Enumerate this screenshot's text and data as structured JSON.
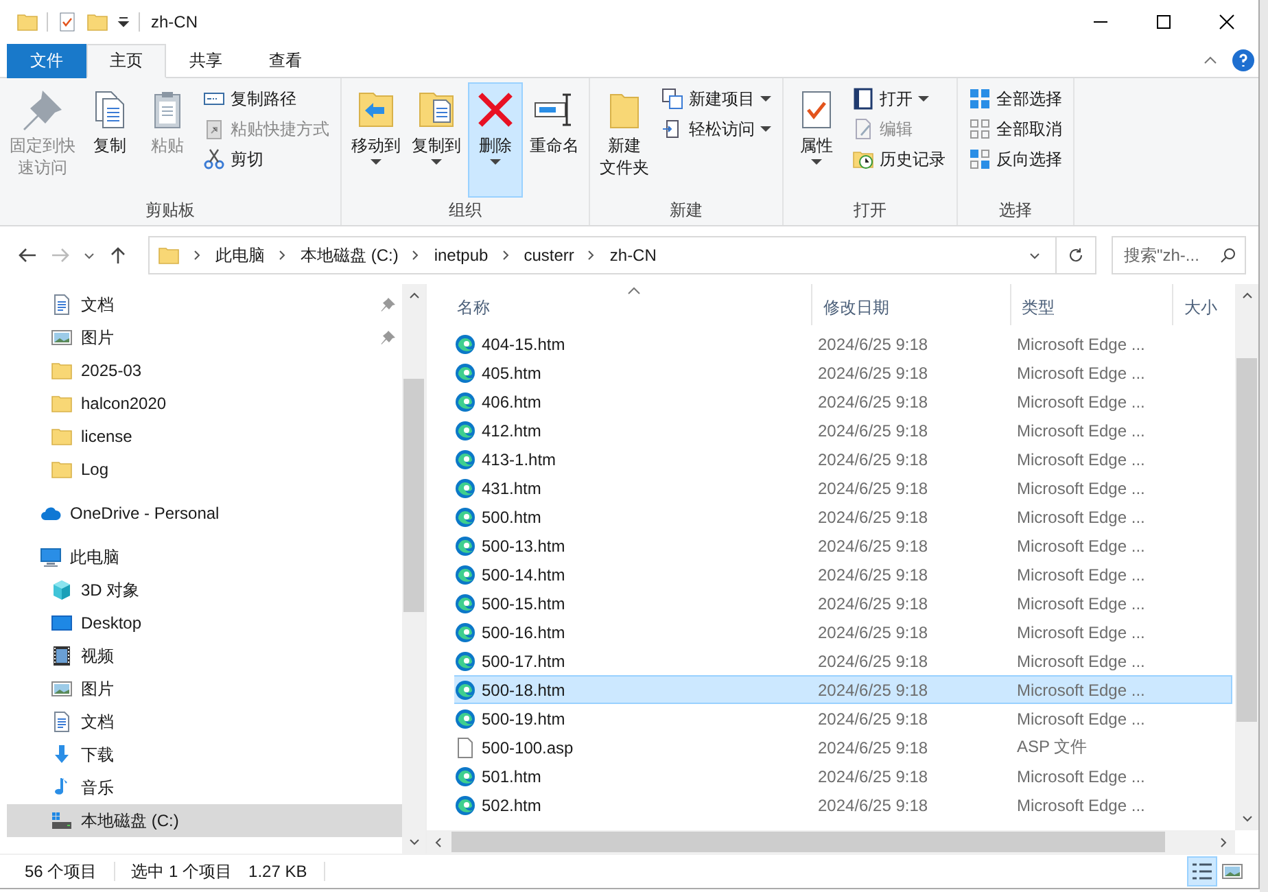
{
  "window": {
    "title": "zh-CN"
  },
  "ribbon_tabs": [
    {
      "label": "文件",
      "kind": "file",
      "selected": false
    },
    {
      "label": "主页",
      "kind": "tab",
      "selected": true
    },
    {
      "label": "共享",
      "kind": "tab",
      "selected": false
    },
    {
      "label": "查看",
      "kind": "tab",
      "selected": false
    }
  ],
  "ribbon_groups": [
    {
      "label": "剪贴板",
      "items": [
        {
          "kind": "large",
          "label": [
            "固定到快",
            "速访问"
          ],
          "dropdown": false,
          "disabled": true,
          "highlighted": false
        },
        {
          "kind": "large",
          "label": [
            "复制"
          ],
          "dropdown": false,
          "disabled": false,
          "highlighted": false
        },
        {
          "kind": "large",
          "label": [
            "粘贴"
          ],
          "dropdown": false,
          "disabled": true,
          "highlighted": false
        },
        {
          "kind": "stack",
          "buttons": [
            {
              "label": "复制路径",
              "dropdown": false,
              "disabled": false
            },
            {
              "label": "粘贴快捷方式",
              "dropdown": false,
              "disabled": true
            },
            {
              "label": "剪切",
              "dropdown": false,
              "disabled": false
            }
          ]
        }
      ]
    },
    {
      "label": "组织",
      "items": [
        {
          "kind": "large",
          "label": [
            "移动到"
          ],
          "dropdown": true,
          "disabled": false,
          "highlighted": false
        },
        {
          "kind": "large",
          "label": [
            "复制到"
          ],
          "dropdown": true,
          "disabled": false,
          "highlighted": false
        },
        {
          "kind": "large",
          "label": [
            "删除"
          ],
          "dropdown": true,
          "disabled": false,
          "highlighted": true
        },
        {
          "kind": "large",
          "label": [
            "重命名"
          ],
          "dropdown": false,
          "disabled": false,
          "highlighted": false
        }
      ]
    },
    {
      "label": "新建",
      "items": [
        {
          "kind": "large",
          "label": [
            "新建",
            "文件夹"
          ],
          "dropdown": false,
          "disabled": false,
          "highlighted": false
        },
        {
          "kind": "stack",
          "buttons": [
            {
              "label": "新建项目",
              "dropdown": true,
              "disabled": false
            },
            {
              "label": "轻松访问",
              "dropdown": true,
              "disabled": false
            }
          ]
        }
      ]
    },
    {
      "label": "打开",
      "items": [
        {
          "kind": "large",
          "label": [
            "属性"
          ],
          "dropdown": true,
          "disabled": false,
          "highlighted": false
        },
        {
          "kind": "stack",
          "buttons": [
            {
              "label": "打开",
              "dropdown": true,
              "disabled": false
            },
            {
              "label": "编辑",
              "dropdown": false,
              "disabled": true
            },
            {
              "label": "历史记录",
              "dropdown": false,
              "disabled": false
            }
          ]
        }
      ]
    },
    {
      "label": "选择",
      "items": [
        {
          "kind": "stack",
          "buttons": [
            {
              "label": "全部选择",
              "dropdown": false,
              "disabled": false
            },
            {
              "label": "全部取消",
              "dropdown": false,
              "disabled": false
            },
            {
              "label": "反向选择",
              "dropdown": false,
              "disabled": false
            }
          ]
        }
      ]
    }
  ],
  "address_bar": {
    "path": [
      "此电脑",
      "本地磁盘 (C:)",
      "inetpub",
      "custerr",
      "zh-CN"
    ]
  },
  "search": {
    "placeholder": "搜索\"zh-..."
  },
  "nav": {
    "quick_access_items": [
      {
        "label": "文档",
        "kind": "document",
        "pinned": true,
        "selected": false
      },
      {
        "label": "图片",
        "kind": "picture",
        "pinned": true,
        "selected": false
      },
      {
        "label": "2025-03",
        "kind": "folder",
        "pinned": false,
        "selected": false
      },
      {
        "label": "halcon2020",
        "kind": "folder",
        "pinned": false,
        "selected": false
      },
      {
        "label": "license",
        "kind": "folder",
        "pinned": false,
        "selected": false
      },
      {
        "label": "Log",
        "kind": "folder",
        "pinned": false,
        "selected": false
      }
    ],
    "roots": [
      {
        "label": "OneDrive - Personal",
        "kind": "cloud",
        "selected": false
      },
      {
        "label": "此电脑",
        "kind": "pc",
        "selected": false,
        "children": [
          {
            "label": "3D 对象",
            "kind": "cube",
            "selected": false
          },
          {
            "label": "Desktop",
            "kind": "desktop",
            "selected": false
          },
          {
            "label": "视频",
            "kind": "video",
            "selected": false
          },
          {
            "label": "图片",
            "kind": "picture",
            "selected": false
          },
          {
            "label": "文档",
            "kind": "document",
            "selected": false
          },
          {
            "label": "下载",
            "kind": "download",
            "selected": false
          },
          {
            "label": "音乐",
            "kind": "music",
            "selected": false
          },
          {
            "label": "本地磁盘 (C:)",
            "kind": "drive",
            "selected": true
          }
        ]
      }
    ]
  },
  "file_list": {
    "columns": [
      "名称",
      "修改日期",
      "类型",
      "大小"
    ],
    "rows": [
      {
        "name": "404-15.htm",
        "date": "2024/6/25 9:18",
        "type": "Microsoft Edge ...",
        "kind": "edge",
        "selected": false
      },
      {
        "name": "405.htm",
        "date": "2024/6/25 9:18",
        "type": "Microsoft Edge ...",
        "kind": "edge",
        "selected": false
      },
      {
        "name": "406.htm",
        "date": "2024/6/25 9:18",
        "type": "Microsoft Edge ...",
        "kind": "edge",
        "selected": false
      },
      {
        "name": "412.htm",
        "date": "2024/6/25 9:18",
        "type": "Microsoft Edge ...",
        "kind": "edge",
        "selected": false
      },
      {
        "name": "413-1.htm",
        "date": "2024/6/25 9:18",
        "type": "Microsoft Edge ...",
        "kind": "edge",
        "selected": false
      },
      {
        "name": "431.htm",
        "date": "2024/6/25 9:18",
        "type": "Microsoft Edge ...",
        "kind": "edge",
        "selected": false
      },
      {
        "name": "500.htm",
        "date": "2024/6/25 9:18",
        "type": "Microsoft Edge ...",
        "kind": "edge",
        "selected": false
      },
      {
        "name": "500-13.htm",
        "date": "2024/6/25 9:18",
        "type": "Microsoft Edge ...",
        "kind": "edge",
        "selected": false
      },
      {
        "name": "500-14.htm",
        "date": "2024/6/25 9:18",
        "type": "Microsoft Edge ...",
        "kind": "edge",
        "selected": false
      },
      {
        "name": "500-15.htm",
        "date": "2024/6/25 9:18",
        "type": "Microsoft Edge ...",
        "kind": "edge",
        "selected": false
      },
      {
        "name": "500-16.htm",
        "date": "2024/6/25 9:18",
        "type": "Microsoft Edge ...",
        "kind": "edge",
        "selected": false
      },
      {
        "name": "500-17.htm",
        "date": "2024/6/25 9:18",
        "type": "Microsoft Edge ...",
        "kind": "edge",
        "selected": false
      },
      {
        "name": "500-18.htm",
        "date": "2024/6/25 9:18",
        "type": "Microsoft Edge ...",
        "kind": "edge",
        "selected": true
      },
      {
        "name": "500-19.htm",
        "date": "2024/6/25 9:18",
        "type": "Microsoft Edge ...",
        "kind": "edge",
        "selected": false
      },
      {
        "name": "500-100.asp",
        "date": "2024/6/25 9:18",
        "type": "ASP 文件",
        "kind": "file",
        "selected": false
      },
      {
        "name": "501.htm",
        "date": "2024/6/25 9:18",
        "type": "Microsoft Edge ...",
        "kind": "edge",
        "selected": false
      },
      {
        "name": "502.htm",
        "date": "2024/6/25 9:18",
        "type": "Microsoft Edge ...",
        "kind": "edge",
        "selected": false
      }
    ]
  },
  "status_bar": {
    "item_count": "56 个项目",
    "selection": "选中 1 个项目",
    "size": "1.27 KB",
    "views": [
      {
        "kind": "details",
        "selected": true
      },
      {
        "kind": "large-icons",
        "selected": false
      }
    ]
  }
}
